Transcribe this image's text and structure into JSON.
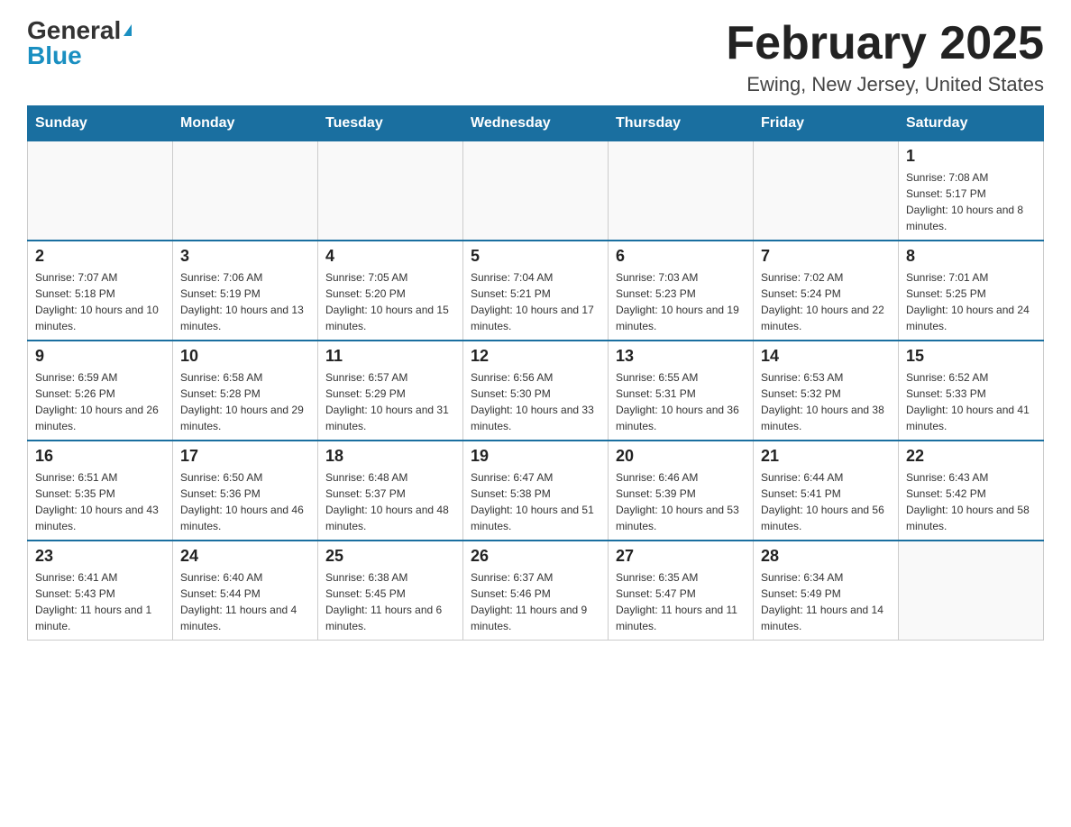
{
  "logo": {
    "general": "General",
    "blue": "Blue",
    "triangle": "▲"
  },
  "header": {
    "month_year": "February 2025",
    "location": "Ewing, New Jersey, United States"
  },
  "days_of_week": [
    "Sunday",
    "Monday",
    "Tuesday",
    "Wednesday",
    "Thursday",
    "Friday",
    "Saturday"
  ],
  "weeks": [
    [
      {
        "day": "",
        "info": ""
      },
      {
        "day": "",
        "info": ""
      },
      {
        "day": "",
        "info": ""
      },
      {
        "day": "",
        "info": ""
      },
      {
        "day": "",
        "info": ""
      },
      {
        "day": "",
        "info": ""
      },
      {
        "day": "1",
        "info": "Sunrise: 7:08 AM\nSunset: 5:17 PM\nDaylight: 10 hours and 8 minutes."
      }
    ],
    [
      {
        "day": "2",
        "info": "Sunrise: 7:07 AM\nSunset: 5:18 PM\nDaylight: 10 hours and 10 minutes."
      },
      {
        "day": "3",
        "info": "Sunrise: 7:06 AM\nSunset: 5:19 PM\nDaylight: 10 hours and 13 minutes."
      },
      {
        "day": "4",
        "info": "Sunrise: 7:05 AM\nSunset: 5:20 PM\nDaylight: 10 hours and 15 minutes."
      },
      {
        "day": "5",
        "info": "Sunrise: 7:04 AM\nSunset: 5:21 PM\nDaylight: 10 hours and 17 minutes."
      },
      {
        "day": "6",
        "info": "Sunrise: 7:03 AM\nSunset: 5:23 PM\nDaylight: 10 hours and 19 minutes."
      },
      {
        "day": "7",
        "info": "Sunrise: 7:02 AM\nSunset: 5:24 PM\nDaylight: 10 hours and 22 minutes."
      },
      {
        "day": "8",
        "info": "Sunrise: 7:01 AM\nSunset: 5:25 PM\nDaylight: 10 hours and 24 minutes."
      }
    ],
    [
      {
        "day": "9",
        "info": "Sunrise: 6:59 AM\nSunset: 5:26 PM\nDaylight: 10 hours and 26 minutes."
      },
      {
        "day": "10",
        "info": "Sunrise: 6:58 AM\nSunset: 5:28 PM\nDaylight: 10 hours and 29 minutes."
      },
      {
        "day": "11",
        "info": "Sunrise: 6:57 AM\nSunset: 5:29 PM\nDaylight: 10 hours and 31 minutes."
      },
      {
        "day": "12",
        "info": "Sunrise: 6:56 AM\nSunset: 5:30 PM\nDaylight: 10 hours and 33 minutes."
      },
      {
        "day": "13",
        "info": "Sunrise: 6:55 AM\nSunset: 5:31 PM\nDaylight: 10 hours and 36 minutes."
      },
      {
        "day": "14",
        "info": "Sunrise: 6:53 AM\nSunset: 5:32 PM\nDaylight: 10 hours and 38 minutes."
      },
      {
        "day": "15",
        "info": "Sunrise: 6:52 AM\nSunset: 5:33 PM\nDaylight: 10 hours and 41 minutes."
      }
    ],
    [
      {
        "day": "16",
        "info": "Sunrise: 6:51 AM\nSunset: 5:35 PM\nDaylight: 10 hours and 43 minutes."
      },
      {
        "day": "17",
        "info": "Sunrise: 6:50 AM\nSunset: 5:36 PM\nDaylight: 10 hours and 46 minutes."
      },
      {
        "day": "18",
        "info": "Sunrise: 6:48 AM\nSunset: 5:37 PM\nDaylight: 10 hours and 48 minutes."
      },
      {
        "day": "19",
        "info": "Sunrise: 6:47 AM\nSunset: 5:38 PM\nDaylight: 10 hours and 51 minutes."
      },
      {
        "day": "20",
        "info": "Sunrise: 6:46 AM\nSunset: 5:39 PM\nDaylight: 10 hours and 53 minutes."
      },
      {
        "day": "21",
        "info": "Sunrise: 6:44 AM\nSunset: 5:41 PM\nDaylight: 10 hours and 56 minutes."
      },
      {
        "day": "22",
        "info": "Sunrise: 6:43 AM\nSunset: 5:42 PM\nDaylight: 10 hours and 58 minutes."
      }
    ],
    [
      {
        "day": "23",
        "info": "Sunrise: 6:41 AM\nSunset: 5:43 PM\nDaylight: 11 hours and 1 minute."
      },
      {
        "day": "24",
        "info": "Sunrise: 6:40 AM\nSunset: 5:44 PM\nDaylight: 11 hours and 4 minutes."
      },
      {
        "day": "25",
        "info": "Sunrise: 6:38 AM\nSunset: 5:45 PM\nDaylight: 11 hours and 6 minutes."
      },
      {
        "day": "26",
        "info": "Sunrise: 6:37 AM\nSunset: 5:46 PM\nDaylight: 11 hours and 9 minutes."
      },
      {
        "day": "27",
        "info": "Sunrise: 6:35 AM\nSunset: 5:47 PM\nDaylight: 11 hours and 11 minutes."
      },
      {
        "day": "28",
        "info": "Sunrise: 6:34 AM\nSunset: 5:49 PM\nDaylight: 11 hours and 14 minutes."
      },
      {
        "day": "",
        "info": ""
      }
    ]
  ]
}
